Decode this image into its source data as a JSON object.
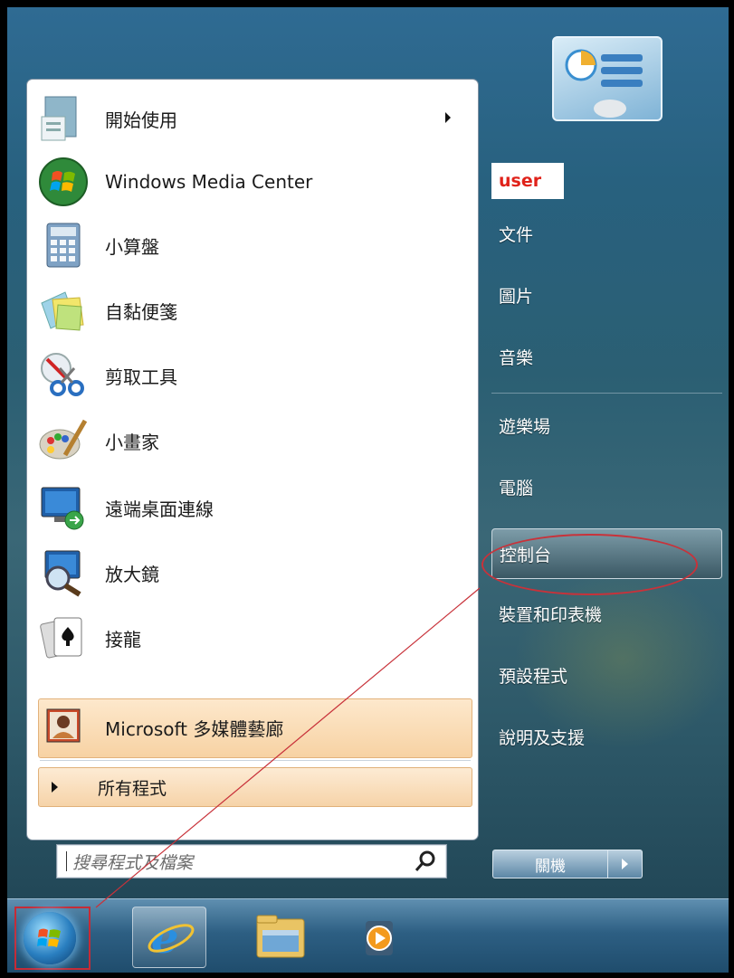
{
  "start_menu": {
    "programs": [
      {
        "label": "開始使用",
        "icon": "getting-started-icon",
        "has_submenu": true
      },
      {
        "label": "Windows Media Center",
        "icon": "windows-media-center-icon"
      },
      {
        "label": "小算盤",
        "icon": "calculator-icon"
      },
      {
        "label": "自黏便箋",
        "icon": "sticky-notes-icon"
      },
      {
        "label": "剪取工具",
        "icon": "snipping-tool-icon"
      },
      {
        "label": "小畫家",
        "icon": "paint-icon"
      },
      {
        "label": "遠端桌面連線",
        "icon": "remote-desktop-icon"
      },
      {
        "label": "放大鏡",
        "icon": "magnifier-icon"
      },
      {
        "label": "接龍",
        "icon": "solitaire-icon"
      },
      {
        "label": "Microsoft 多媒體藝廊",
        "icon": "media-gallery-icon",
        "highlighted": true
      }
    ],
    "all_programs": "所有程式",
    "search_placeholder": "搜尋程式及檔案",
    "user_name": "user",
    "right_items": [
      {
        "label": "文件"
      },
      {
        "label": "圖片"
      },
      {
        "label": "音樂"
      },
      {
        "label": "遊樂場"
      },
      {
        "label": "電腦"
      },
      {
        "label": "控制台",
        "selected": true
      },
      {
        "label": "裝置和印表機"
      },
      {
        "label": "預設程式"
      },
      {
        "label": "說明及支援"
      }
    ],
    "shutdown_label": "關機"
  },
  "taskbar": {
    "items": [
      "start-orb-icon",
      "internet-explorer-icon",
      "windows-explorer-icon",
      "media-player-icon"
    ]
  },
  "colors": {
    "annotation": "#c8323a",
    "user_label": "#e0221a",
    "highlight": "#f7d2a3"
  }
}
